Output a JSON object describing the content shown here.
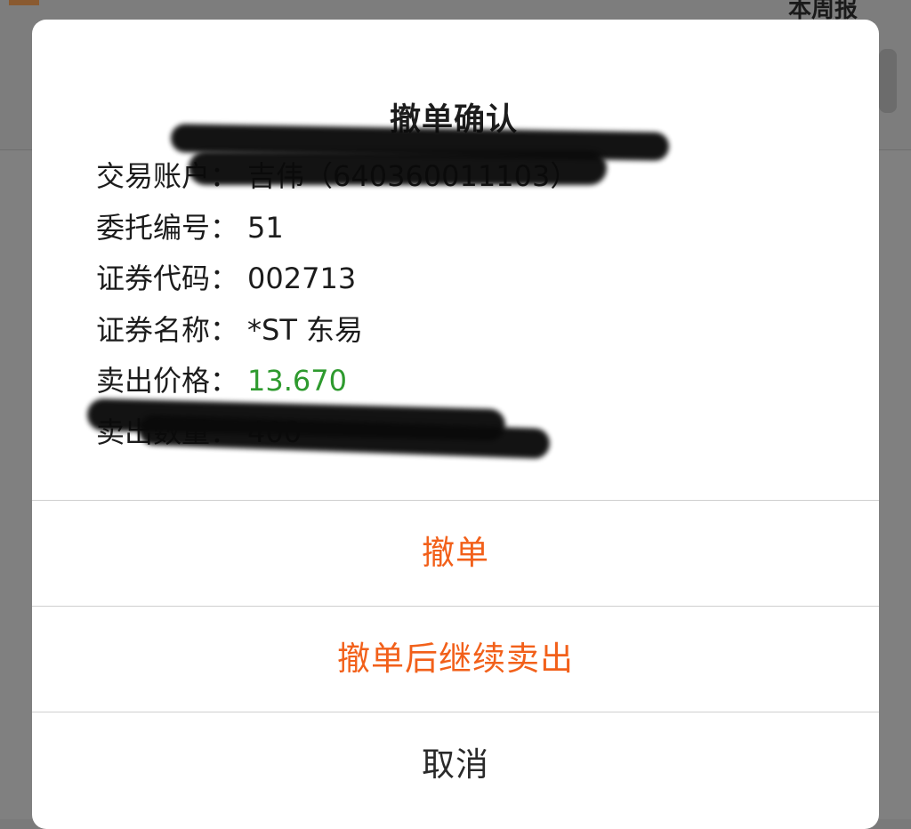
{
  "background": {
    "top_right_text": "本周报"
  },
  "dialog": {
    "title": "撤单确认",
    "rows": [
      {
        "label": "交易账户：",
        "value": "吉伟（640360011103）",
        "redacted": true
      },
      {
        "label": "委托编号：",
        "value": "51"
      },
      {
        "label": "证券代码：",
        "value": "002713"
      },
      {
        "label": "证券名称：",
        "value": "*ST 东易"
      },
      {
        "label": "卖出价格：",
        "value": "13.670",
        "color": "#2e9a2e"
      },
      {
        "label": "卖出数量：",
        "value": "400",
        "redacted": true
      }
    ],
    "actions": {
      "cancel_order": "撤单",
      "cancel_and_sell": "撤单后继续卖出",
      "dismiss": "取消"
    }
  },
  "colors": {
    "accent": "#f2601a",
    "price_green": "#2e9a2e",
    "text": "#1c1c1c",
    "divider": "#cfcfcf"
  }
}
